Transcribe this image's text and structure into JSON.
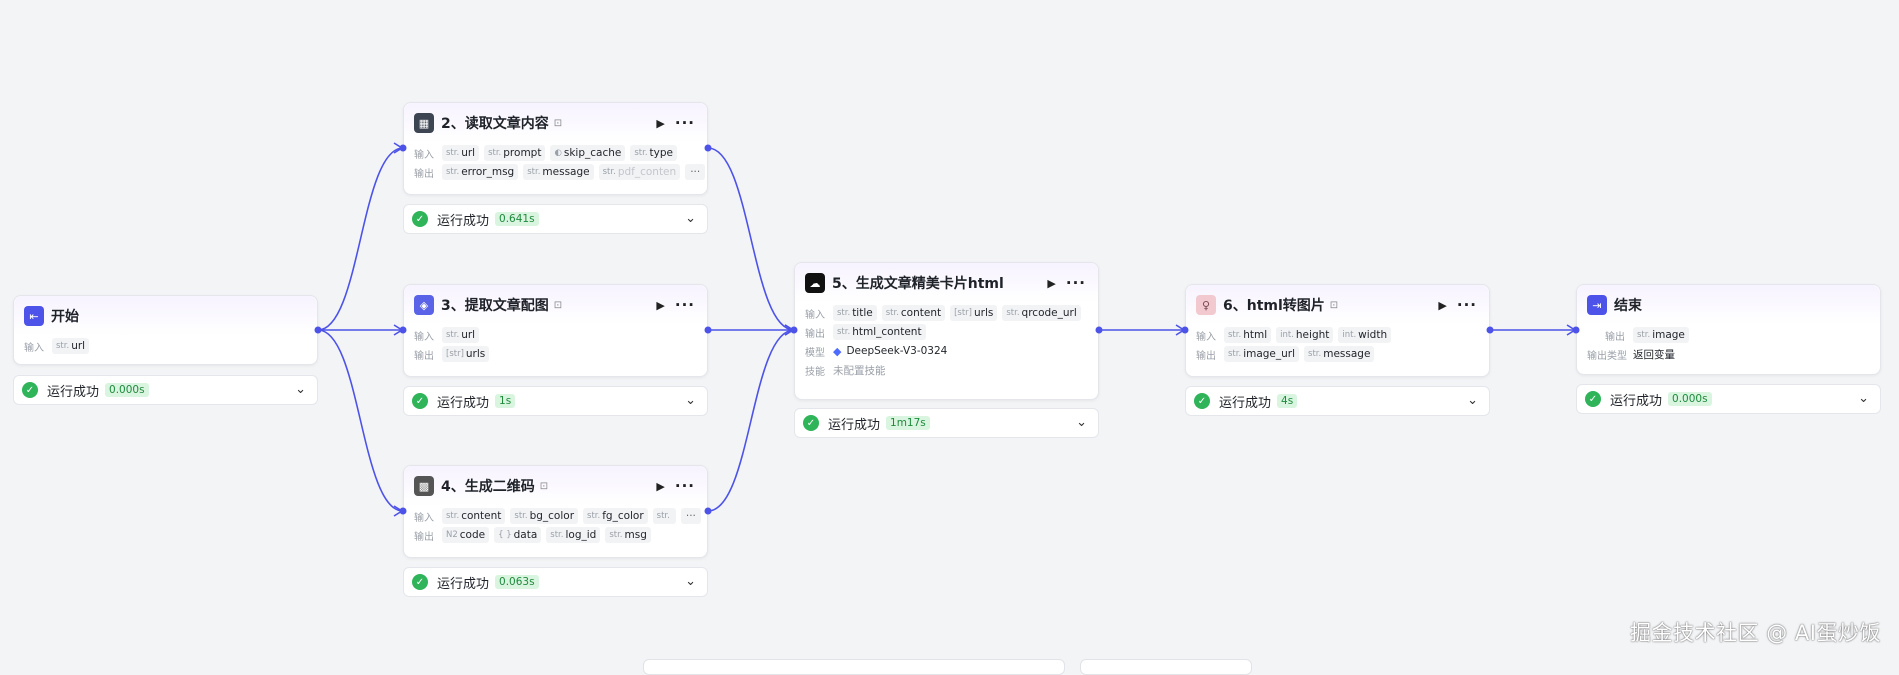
{
  "canvas": {
    "edge_color": "#4d53e8",
    "success_color": "#2fb45a",
    "badge_bg": "#d9f5df",
    "labels": {
      "input": "输入",
      "output": "输出",
      "model": "模型",
      "skill": "技能",
      "output_type": "输出类型"
    }
  },
  "nodes": {
    "start": {
      "title": "开始",
      "icon": "start-icon",
      "inputs": [
        {
          "type": "str.",
          "name": "url"
        }
      ],
      "status": "运行成功",
      "time": "0.000s"
    },
    "read_article": {
      "title": "2、读取文章内容",
      "icon": "article-reader-icon",
      "inputs": [
        {
          "type": "str.",
          "name": "url"
        },
        {
          "type": "str.",
          "name": "prompt"
        },
        {
          "type": "◐",
          "name": "skip_cache"
        },
        {
          "type": "str.",
          "name": "type"
        }
      ],
      "outputs": [
        {
          "type": "str.",
          "name": "error_msg"
        },
        {
          "type": "str.",
          "name": "message"
        },
        {
          "type": "str.",
          "name": "pdf_conten"
        }
      ],
      "more": "···",
      "status": "运行成功",
      "time": "0.641s"
    },
    "extract_images": {
      "title": "3、提取文章配图",
      "icon": "cube-icon",
      "inputs": [
        {
          "type": "str.",
          "name": "url"
        }
      ],
      "outputs": [
        {
          "type": "[str]",
          "name": "urls"
        }
      ],
      "status": "运行成功",
      "time": "1s"
    },
    "qrcode": {
      "title": "4、生成二维码",
      "icon": "qrcode-icon",
      "inputs": [
        {
          "type": "str.",
          "name": "content"
        },
        {
          "type": "str.",
          "name": "bg_color"
        },
        {
          "type": "str.",
          "name": "fg_color"
        },
        {
          "type": "str.",
          "name": ""
        }
      ],
      "outputs": [
        {
          "type": "N2",
          "name": "code"
        },
        {
          "type": "{ }",
          "name": "data"
        },
        {
          "type": "str.",
          "name": "log_id"
        },
        {
          "type": "str.",
          "name": "msg"
        }
      ],
      "more": "···",
      "status": "运行成功",
      "time": "0.063s"
    },
    "card_html": {
      "title": "5、生成文章精美卡片html",
      "icon": "llm-icon",
      "inputs": [
        {
          "type": "str.",
          "name": "title"
        },
        {
          "type": "str.",
          "name": "content"
        },
        {
          "type": "[str]",
          "name": "urls"
        },
        {
          "type": "str.",
          "name": "qrcode_url"
        }
      ],
      "outputs": [
        {
          "type": "str.",
          "name": "html_content"
        }
      ],
      "model": "DeepSeek-V3-0324",
      "skill": "未配置技能",
      "status": "运行成功",
      "time": "1m17s"
    },
    "html_to_image": {
      "title": "6、html转图片",
      "icon": "avatar-icon",
      "inputs": [
        {
          "type": "str.",
          "name": "html"
        },
        {
          "type": "int.",
          "name": "height"
        },
        {
          "type": "int.",
          "name": "width"
        }
      ],
      "outputs": [
        {
          "type": "str.",
          "name": "image_url"
        },
        {
          "type": "str.",
          "name": "message"
        }
      ],
      "status": "运行成功",
      "time": "4s"
    },
    "end": {
      "title": "结束",
      "icon": "end-icon",
      "outputs": [
        {
          "type": "str.",
          "name": "image"
        }
      ],
      "output_type_value": "返回变量",
      "status": "运行成功",
      "time": "0.000s"
    }
  },
  "watermark": "掘金技术社区 @ AI蛋炒饭"
}
